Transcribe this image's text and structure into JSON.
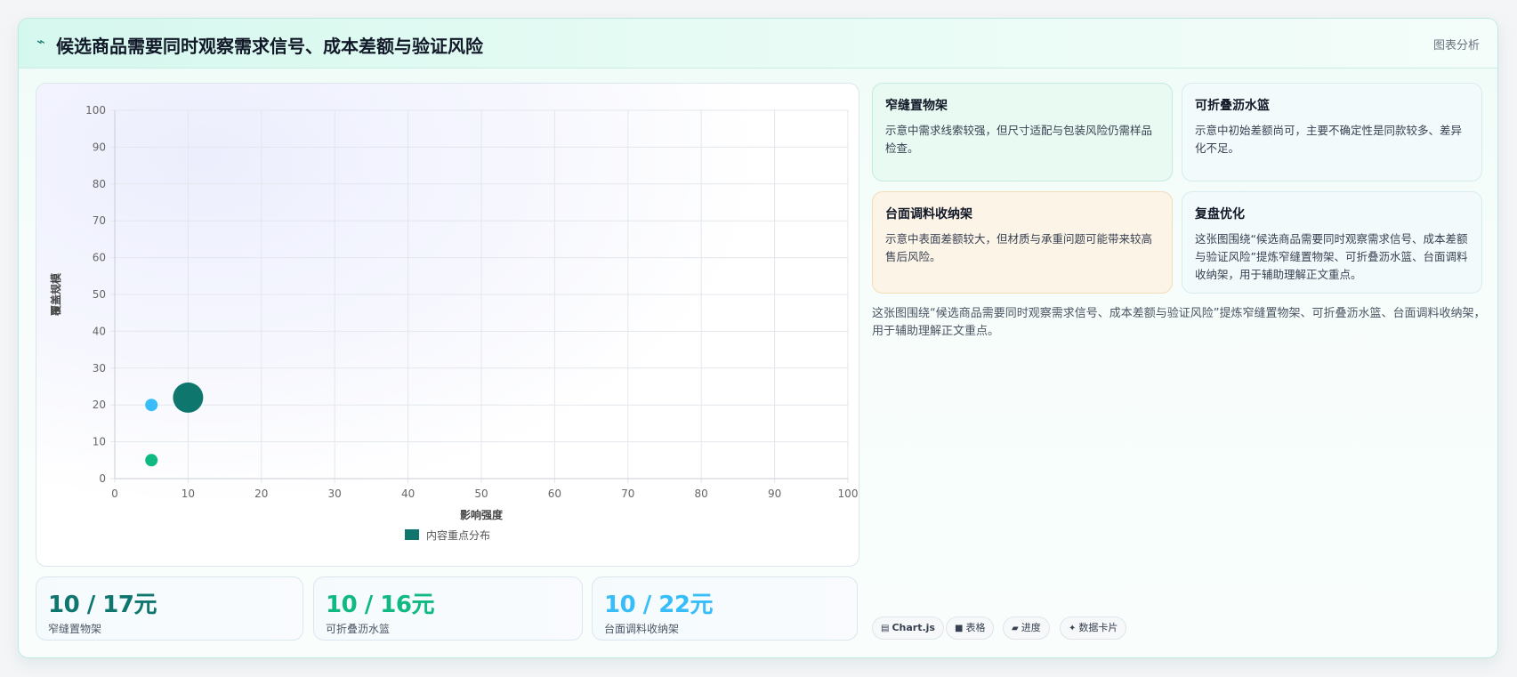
{
  "header": {
    "title": "候选商品需要同时观察需求信号、成本差额与验证风险",
    "tag": "图表分析"
  },
  "chart_data": {
    "type": "scatter",
    "x_label": "影响强度",
    "y_label": "覆盖规模",
    "x_range": [
      0,
      100
    ],
    "y_range": [
      0,
      100
    ],
    "x_ticks": [
      0,
      10,
      20,
      30,
      40,
      50,
      60,
      70,
      80,
      90,
      100
    ],
    "y_ticks": [
      0,
      10,
      20,
      30,
      40,
      50,
      60,
      70,
      80,
      90,
      100
    ],
    "grid": true,
    "legend_position": "bottom",
    "series": [
      {
        "name": "内容重点分布",
        "points": [
          {
            "x": 10,
            "y": 22,
            "r": 17,
            "color": "#0f766e"
          },
          {
            "x": 5,
            "y": 20,
            "r": 7,
            "color": "#38bdf8"
          },
          {
            "x": 5,
            "y": 5,
            "r": 7,
            "color": "#10b981"
          }
        ]
      }
    ]
  },
  "cards": [
    {
      "title": "窄缝置物架",
      "body": "示意中需求线索较强，但尺寸适配与包装风险仍需样品检查。"
    },
    {
      "title": "可折叠沥水篮",
      "body": "示意中初始差额尚可，主要不确定性是同款较多、差异化不足。"
    },
    {
      "title": "台面调料收纳架",
      "body": "示意中表面差额较大，但材质与承重问题可能带来较高售后风险。"
    },
    {
      "title": "复盘优化",
      "body": "这张图围绕“候选商品需要同时观察需求信号、成本差额与验证风险”提炼窄缝置物架、可折叠沥水篮、台面调料收纳架，用于辅助理解正文重点。"
    }
  ],
  "summary": "这张图围绕“候选商品需要同时观察需求信号、成本差额与验证风险”提炼窄缝置物架、可折叠沥水篮、台面调料收纳架，用于辅助理解正文重点。",
  "kpis": [
    {
      "value": "10 / 17元",
      "label": "窄缝置物架",
      "color": "#0f766e"
    },
    {
      "value": "10 / 16元",
      "label": "可折叠沥水篮",
      "color": "#10b981"
    },
    {
      "value": "10 / 22元",
      "label": "台面调料收纳架",
      "color": "#38bdf8"
    }
  ],
  "chips": [
    {
      "icon": "▤",
      "label": "Chart.js"
    },
    {
      "icon": "■",
      "label": "表格"
    },
    {
      "icon": "▰",
      "label": "进度"
    },
    {
      "icon": "✦",
      "label": "数据卡片"
    }
  ]
}
